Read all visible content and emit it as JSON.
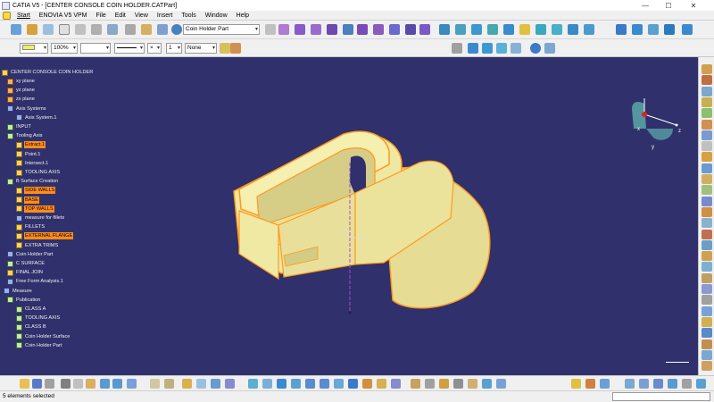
{
  "window": {
    "title": "CATIA V5 - [CENTER CONSOLE COIN HOLDER.CATPart]",
    "minimize": "—",
    "maximize": "☐",
    "close": "✕"
  },
  "menu": [
    "Start",
    "ENOVIA V5 VPM",
    "File",
    "Edit",
    "View",
    "Insert",
    "Tools",
    "Window",
    "Help"
  ],
  "toolbar": {
    "current_body": "Coin Holder Part",
    "color_percent": "100%",
    "layer_value": "None",
    "thickness_value": "1"
  },
  "tree": {
    "root": "CENTER CONSOLE COIN HOLDER",
    "items": [
      {
        "label": "xy plane",
        "level": 1,
        "icon": "plane-icon"
      },
      {
        "label": "yz plane",
        "level": 1,
        "icon": "plane-icon"
      },
      {
        "label": "zx plane",
        "level": 1,
        "icon": "plane-icon"
      },
      {
        "label": "Axis Systems",
        "level": 1,
        "icon": "axis-systems-icon"
      },
      {
        "label": "Axis System.1",
        "level": 2,
        "icon": "axis-system-icon"
      },
      {
        "label": "INPUT",
        "level": 1,
        "icon": "geometrical-set-icon"
      },
      {
        "label": "Tooling Axis",
        "level": 1,
        "icon": "geometrical-set-icon"
      },
      {
        "label": "Extract.1",
        "level": 2,
        "icon": "extract-icon",
        "highlight": true
      },
      {
        "label": "Point.1",
        "level": 2,
        "icon": "point-icon"
      },
      {
        "label": "Intersect.1",
        "level": 2,
        "icon": "intersect-icon"
      },
      {
        "label": "TOOLING AXIS",
        "level": 2,
        "icon": "line-icon"
      },
      {
        "label": "B Surface Creation",
        "level": 1,
        "icon": "geometrical-set-icon"
      },
      {
        "label": "SIDE WALLS",
        "level": 2,
        "icon": "surface-icon",
        "highlight": true
      },
      {
        "label": "BASE",
        "level": 2,
        "icon": "surface-icon",
        "highlight": true
      },
      {
        "label": "TOP WALLS",
        "level": 2,
        "icon": "surface-icon",
        "highlight": true
      },
      {
        "label": "measure for fillets",
        "level": 2,
        "icon": "measure-icon"
      },
      {
        "label": "FILLETS",
        "level": 2,
        "icon": "fillet-icon"
      },
      {
        "label": "EXTERNAL FLANGE",
        "level": 2,
        "icon": "surface-icon",
        "highlight": true
      },
      {
        "label": "EXTRA TRIMS",
        "level": 2,
        "icon": "trim-icon"
      },
      {
        "label": "Coin Holder Part",
        "level": 1,
        "icon": "body-icon"
      },
      {
        "label": "C SURFACE",
        "level": 1,
        "icon": "geometrical-set-icon"
      },
      {
        "label": "FINAL JOIN",
        "level": 1,
        "icon": "join-icon"
      },
      {
        "label": "Free Form Analysis.1",
        "level": 1,
        "icon": "analysis-icon"
      },
      {
        "label": "Measure",
        "level": 0,
        "icon": "measure-icon"
      },
      {
        "label": "Publication",
        "level": 1,
        "icon": "publication-icon"
      },
      {
        "label": "CLASS A",
        "level": 2,
        "icon": "publication-item-icon"
      },
      {
        "label": "TOOLING AXIS",
        "level": 2,
        "icon": "publication-item-icon"
      },
      {
        "label": "CLASS B",
        "level": 2,
        "icon": "publication-item-icon"
      },
      {
        "label": "Coin Holder Surface",
        "level": 2,
        "icon": "publication-item-icon"
      },
      {
        "label": "Coin Holder Part",
        "level": 2,
        "icon": "publication-item-icon"
      }
    ]
  },
  "compass": {
    "x_label": "x",
    "y_label": "y",
    "z_label": "z"
  },
  "status": {
    "text": "5 elements selected"
  },
  "colors": {
    "background": "#2f306c",
    "part_fill": "#efe8a2",
    "selection_edge": "#ff9a1e",
    "tree_highlight": "#ff8c1a"
  }
}
